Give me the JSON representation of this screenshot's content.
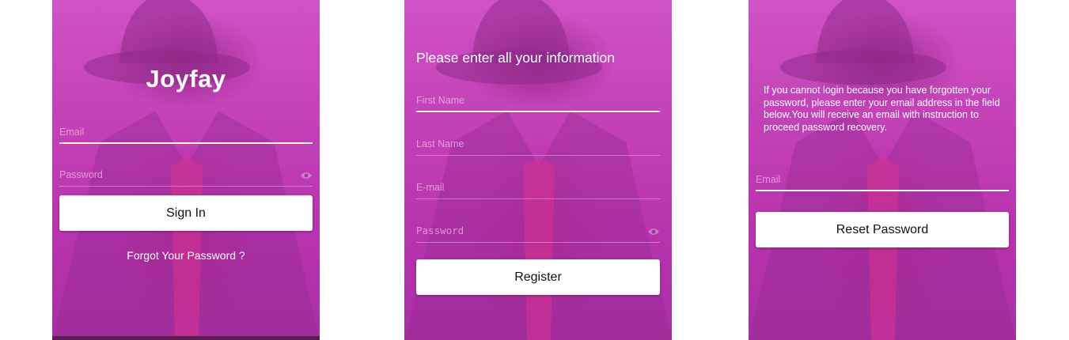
{
  "login": {
    "app_name": "Joyfay",
    "email_placeholder": "Email",
    "password_placeholder": "Password",
    "sign_in_label": "Sign In",
    "forgot_link": "Forgot Your Password ?"
  },
  "register": {
    "heading": "Please enter all your information",
    "first_name_placeholder": "First Name",
    "last_name_placeholder": "Last Name",
    "email_placeholder": "E-mail",
    "password_placeholder": "Password",
    "register_label": "Register"
  },
  "reset": {
    "info_text": "If you cannot login because you have forgotten your password, please enter your email address in the field below.You will receive an email with instruction to proceed password recovery.",
    "email_placeholder": "Email",
    "reset_label": "Reset Password"
  },
  "icons": {
    "password_toggle": "eye-icon"
  },
  "colors": {
    "overlay": "#c23fb6",
    "button_bg": "#ffffff",
    "text_light": "#ffffff"
  }
}
